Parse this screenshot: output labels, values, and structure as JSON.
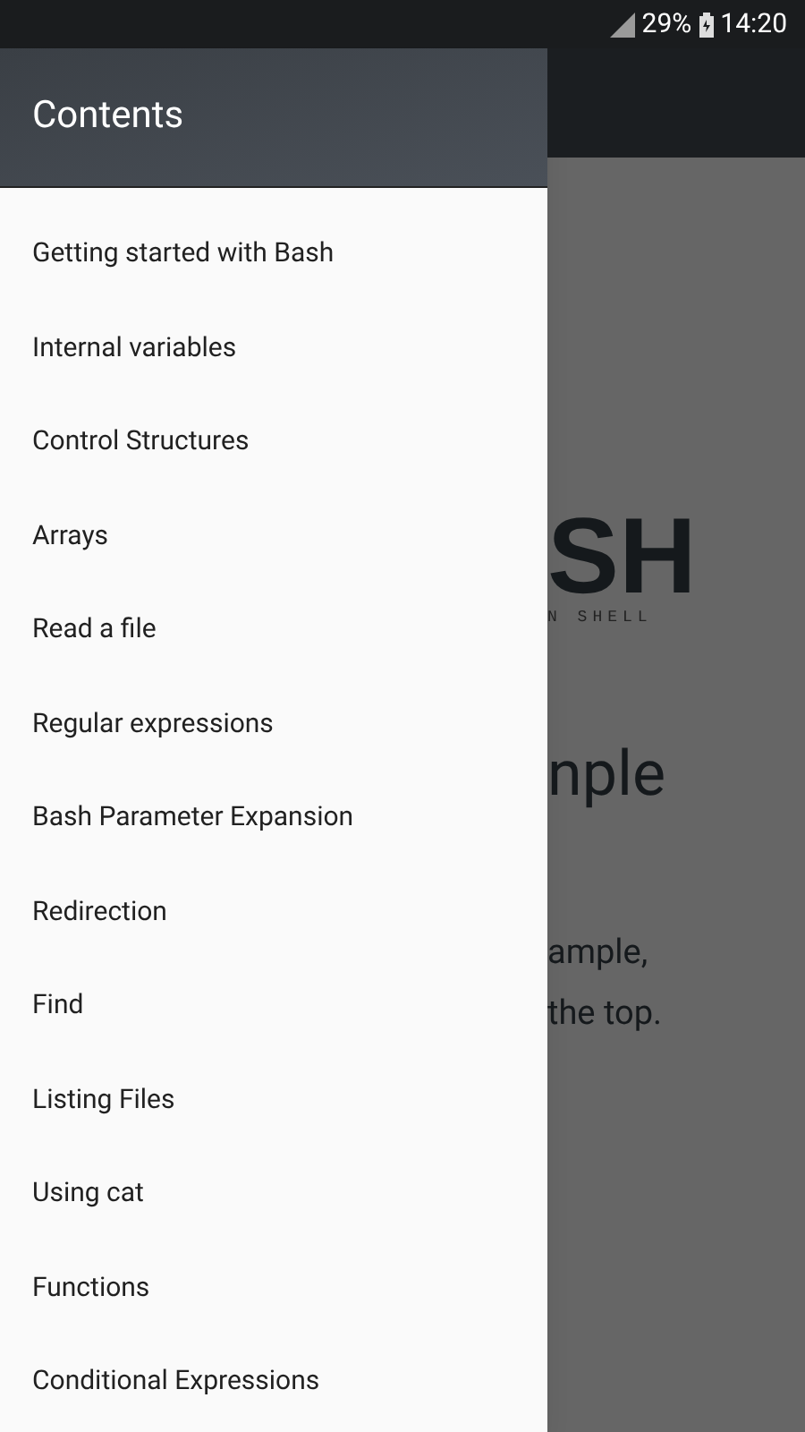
{
  "status_bar": {
    "battery": "29%",
    "time": "14:20"
  },
  "drawer": {
    "title": "Contents",
    "items": [
      {
        "label": "Getting started with Bash"
      },
      {
        "label": "Internal variables"
      },
      {
        "label": "Control Structures"
      },
      {
        "label": "Arrays"
      },
      {
        "label": "Read a file"
      },
      {
        "label": "Regular expressions"
      },
      {
        "label": "Bash Parameter Expansion"
      },
      {
        "label": "Redirection"
      },
      {
        "label": "Find"
      },
      {
        "label": "Listing Files"
      },
      {
        "label": "Using cat"
      },
      {
        "label": "Functions"
      },
      {
        "label": "Conditional Expressions"
      }
    ]
  },
  "background_page": {
    "logo": "SH",
    "logo_subtitle": "N SHELL",
    "heading": "nple",
    "paragraph_lines": [
      "ample,",
      "the top."
    ]
  }
}
